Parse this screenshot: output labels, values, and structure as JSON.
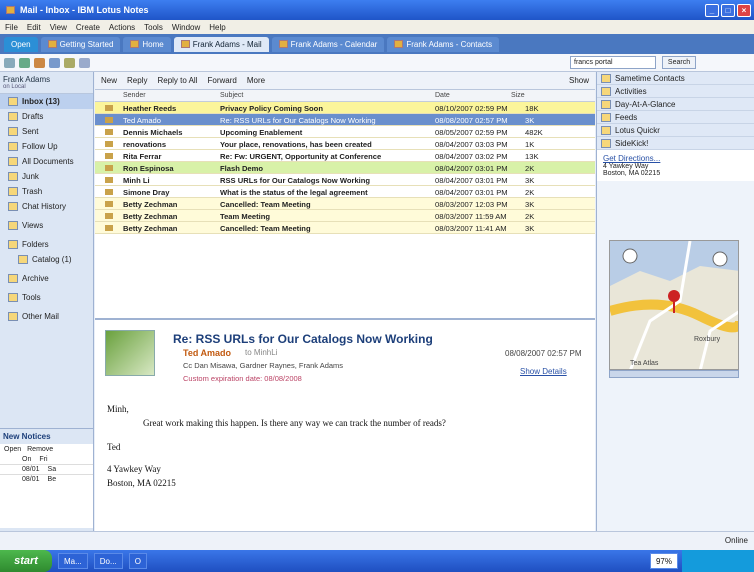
{
  "window": {
    "title": "Mail - Inbox - IBM Lotus Notes"
  },
  "menu": [
    "File",
    "Edit",
    "View",
    "Create",
    "Actions",
    "Tools",
    "Window",
    "Help"
  ],
  "tabs": [
    {
      "label": "Open"
    },
    {
      "label": "Getting Started"
    },
    {
      "label": "Home"
    },
    {
      "label": "Frank Adams - Mail"
    },
    {
      "label": "Frank Adams - Calendar"
    },
    {
      "label": "Frank Adams - Contacts"
    }
  ],
  "toolbar": {
    "search_scope": "francs portal",
    "search_button": "Search"
  },
  "leftnav": {
    "owner": "Frank Adams",
    "location": "on Local",
    "items": [
      "Inbox (13)",
      "Drafts",
      "Sent",
      "Follow Up",
      "All Documents",
      "Junk",
      "Trash",
      "Chat History",
      "Views",
      "Folders",
      "Catalog (1)",
      "Archive",
      "Tools",
      "Other Mail"
    ],
    "notices_title": "New Notices",
    "notices_actions": [
      "Open",
      "Remove"
    ],
    "notices_rows": [
      {
        "col1": "On",
        "col2": "Fri"
      },
      {
        "col1": "08/01",
        "col2": "Sa"
      },
      {
        "col1": "08/01",
        "col2": "Be"
      }
    ]
  },
  "actionbar": {
    "new": "New",
    "reply": "Reply",
    "reply_all": "Reply to All",
    "forward": "Forward",
    "more": "More",
    "show": "Show"
  },
  "columns": {
    "sender": "Sender",
    "subject": "Subject",
    "date": "Date",
    "size": "Size"
  },
  "messages": [
    {
      "sender": "Heather Reeds",
      "subject": "Privacy Policy Coming Soon",
      "date": "08/10/2007 02:59 PM",
      "size": "18K",
      "color": "y"
    },
    {
      "sender": "Ted Amado",
      "subject": "Re: RSS URLs for Our Catalogs Now Working",
      "date": "08/08/2007 02:57 PM",
      "size": "3K",
      "color": "s"
    },
    {
      "sender": "Dennis Michaels",
      "subject": "Upcoming Enablement",
      "date": "08/05/2007 02:59 PM",
      "size": "482K",
      "color": ""
    },
    {
      "sender": "renovations",
      "subject": "Your place, renovations, has been created",
      "date": "08/04/2007 03:03 PM",
      "size": "1K",
      "color": ""
    },
    {
      "sender": "Rita Ferrar",
      "subject": "Re: Fw: URGENT, Opportunity at Conference",
      "date": "08/04/2007 03:02 PM",
      "size": "13K",
      "color": ""
    },
    {
      "sender": "Ron Espinosa",
      "subject": "Flash Demo",
      "date": "08/04/2007 03:01 PM",
      "size": "2K",
      "color": "g"
    },
    {
      "sender": "Minh Li",
      "subject": "RSS URLs for Our Catalogs Now Working",
      "date": "08/04/2007 03:01 PM",
      "size": "3K",
      "color": ""
    },
    {
      "sender": "Simone Dray",
      "subject": "What is the status of the legal agreement",
      "date": "08/04/2007 03:01 PM",
      "size": "2K",
      "color": ""
    },
    {
      "sender": "Betty Zechman",
      "subject": "Cancelled: Team Meeting",
      "date": "08/03/2007 12:03 PM",
      "size": "3K",
      "color": "p"
    },
    {
      "sender": "Betty Zechman",
      "subject": "Team Meeting",
      "date": "08/03/2007 11:59 AM",
      "size": "2K",
      "color": "p"
    },
    {
      "sender": "Betty Zechman",
      "subject": "Cancelled: Team Meeting",
      "date": "08/03/2007 11:41 AM",
      "size": "3K",
      "color": "p"
    }
  ],
  "preview": {
    "subject": "Re: RSS URLs for Our Catalogs Now Working",
    "from": "Ted Amado",
    "to": "to MinhLi",
    "cc": "Cc Dan Misawa, Gardner Raynes, Frank Adams",
    "expiration": "Custom expiration date: 08/08/2008",
    "date": "08/08/2007 02:57 PM",
    "show_details": "Show Details",
    "greeting": "Minh,",
    "body": "Great work making this happen. Is there any way we can track the number of reads?",
    "signoff": "Ted",
    "address1": "4 Yawkey Way",
    "address2": "Boston, MA 02215"
  },
  "rightnav": {
    "items": [
      "Sametime Contacts",
      "Activities",
      "Day-At-A-Glance",
      "Feeds",
      "Lotus Quickr",
      "SideKick!"
    ],
    "directions_link": "Get Directions...",
    "addr1": "4 Yawkey Way",
    "addr2": "Boston, MA 02215",
    "map_label1": "Roxbury",
    "map_label2": "Tea Atlas"
  },
  "status": {
    "online": "Online"
  },
  "taskbar": {
    "start": "start",
    "percent": "97%",
    "tasks": [
      "Ma...",
      "Do...",
      "O"
    ]
  }
}
